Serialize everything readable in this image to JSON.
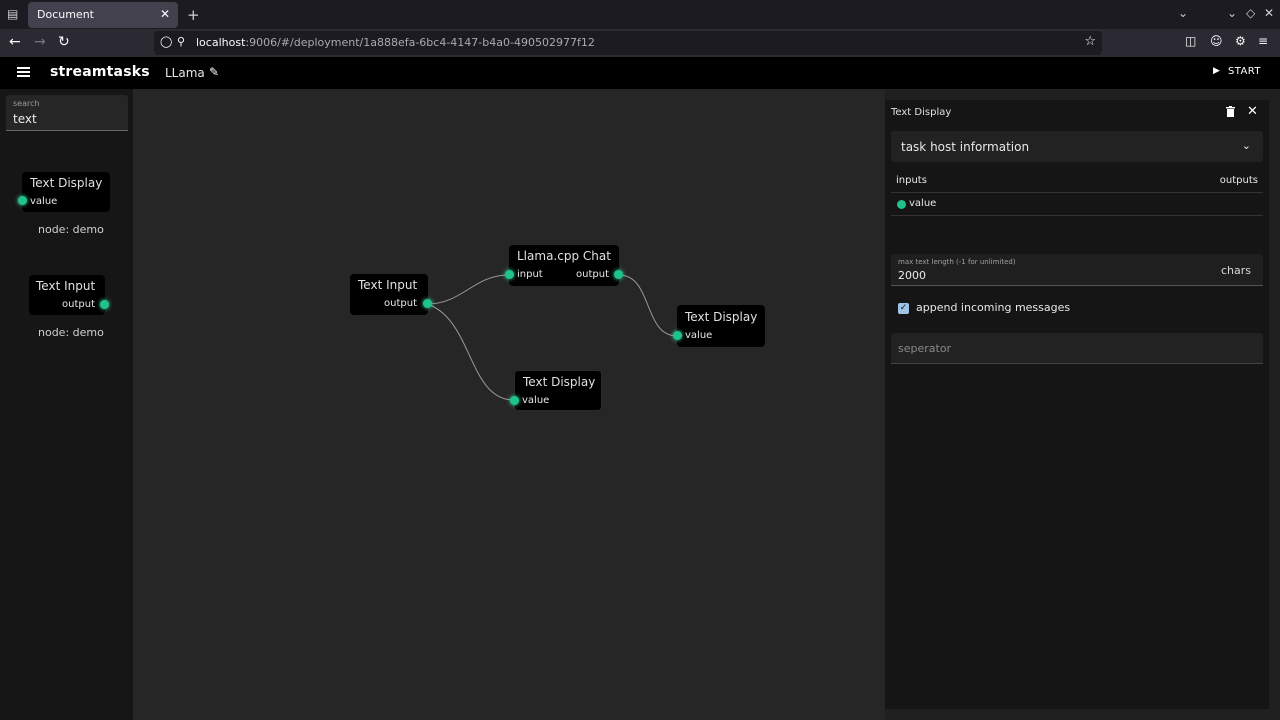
{
  "browser": {
    "tab_title": "Document",
    "url_host": "localhost",
    "url_rest": ":9006/#/deployment/1a888efa-6bc4-4147-b4a0-490502977f12"
  },
  "app": {
    "brand": "streamtasks",
    "project": "LLama",
    "start_label": "START"
  },
  "sidebar": {
    "search_label": "search",
    "search_value": "text",
    "nodes": [
      {
        "title": "Text Display",
        "port": "value",
        "meta": "node: demo"
      },
      {
        "title": "Text Input",
        "port": "output",
        "meta": "node: demo"
      }
    ]
  },
  "canvas": {
    "nodes": [
      {
        "title": "Text Input",
        "ports": {
          "output": "output"
        }
      },
      {
        "title": "Llama.cpp Chat",
        "ports": {
          "input": "input",
          "output": "output"
        }
      },
      {
        "title": "Text Display",
        "ports": {
          "input": "value"
        }
      },
      {
        "title": "Text Display",
        "ports": {
          "input": "value"
        }
      }
    ]
  },
  "panel": {
    "title": "Text Display",
    "accordion": "task host information",
    "inputs_label": "inputs",
    "outputs_label": "outputs",
    "input_port": "value",
    "max_len_label": "max text length (-1 for unlimited)",
    "max_len_value": "2000",
    "max_len_unit": "chars",
    "append_label": "append incoming messages",
    "append_checked": true,
    "separator_placeholder": "seperator"
  },
  "colors": {
    "port": "#1ec48a",
    "node_bg": "#000000",
    "canvas_bg": "#262626",
    "sidebar_bg": "#161616"
  }
}
